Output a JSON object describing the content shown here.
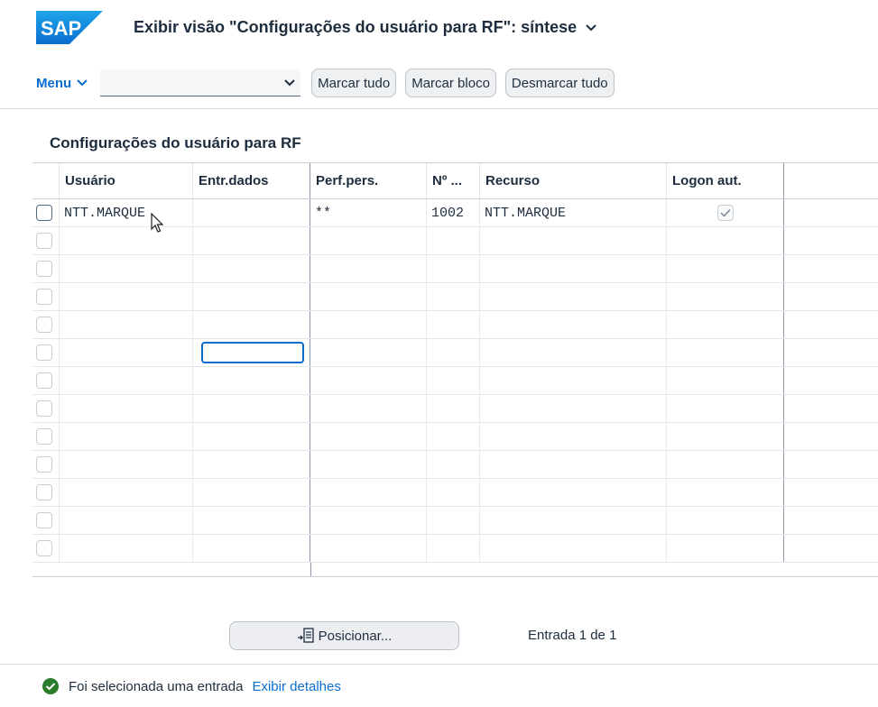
{
  "app": {
    "logo_text": "SAP",
    "title": "Exibir visão \"Configurações do usuário para RF\": síntese"
  },
  "toolbar": {
    "menu_label": "Menu",
    "combo_value": "",
    "buttons": [
      "Marcar tudo",
      "Marcar bloco",
      "Desmarcar tudo"
    ]
  },
  "section": {
    "title": "Configurações do usuário para RF"
  },
  "table": {
    "columns": [
      "Usuário",
      "Entr.dados",
      "Perf.pers.",
      "Nº ...",
      "Recurso",
      "Logon aut."
    ],
    "rows": [
      {
        "usuario": "NTT.MARQUE",
        "entr_dados": "",
        "perf_pers": "**",
        "numero": "1002",
        "recurso": "NTT.MARQUE",
        "logon_aut": true
      }
    ],
    "empty_row_count": 12
  },
  "footer": {
    "position_button": "Posicionar...",
    "entry_count": "Entrada 1 de 1"
  },
  "status": {
    "message": "Foi selecionada uma entrada",
    "link": "Exibir detalhes"
  },
  "colors": {
    "brand": "#0a6ed1",
    "success": "#2b7c2b"
  },
  "icons": [
    "sap-logo",
    "chevron-down-icon",
    "position-icon",
    "success-icon",
    "checkmark-icon"
  ]
}
